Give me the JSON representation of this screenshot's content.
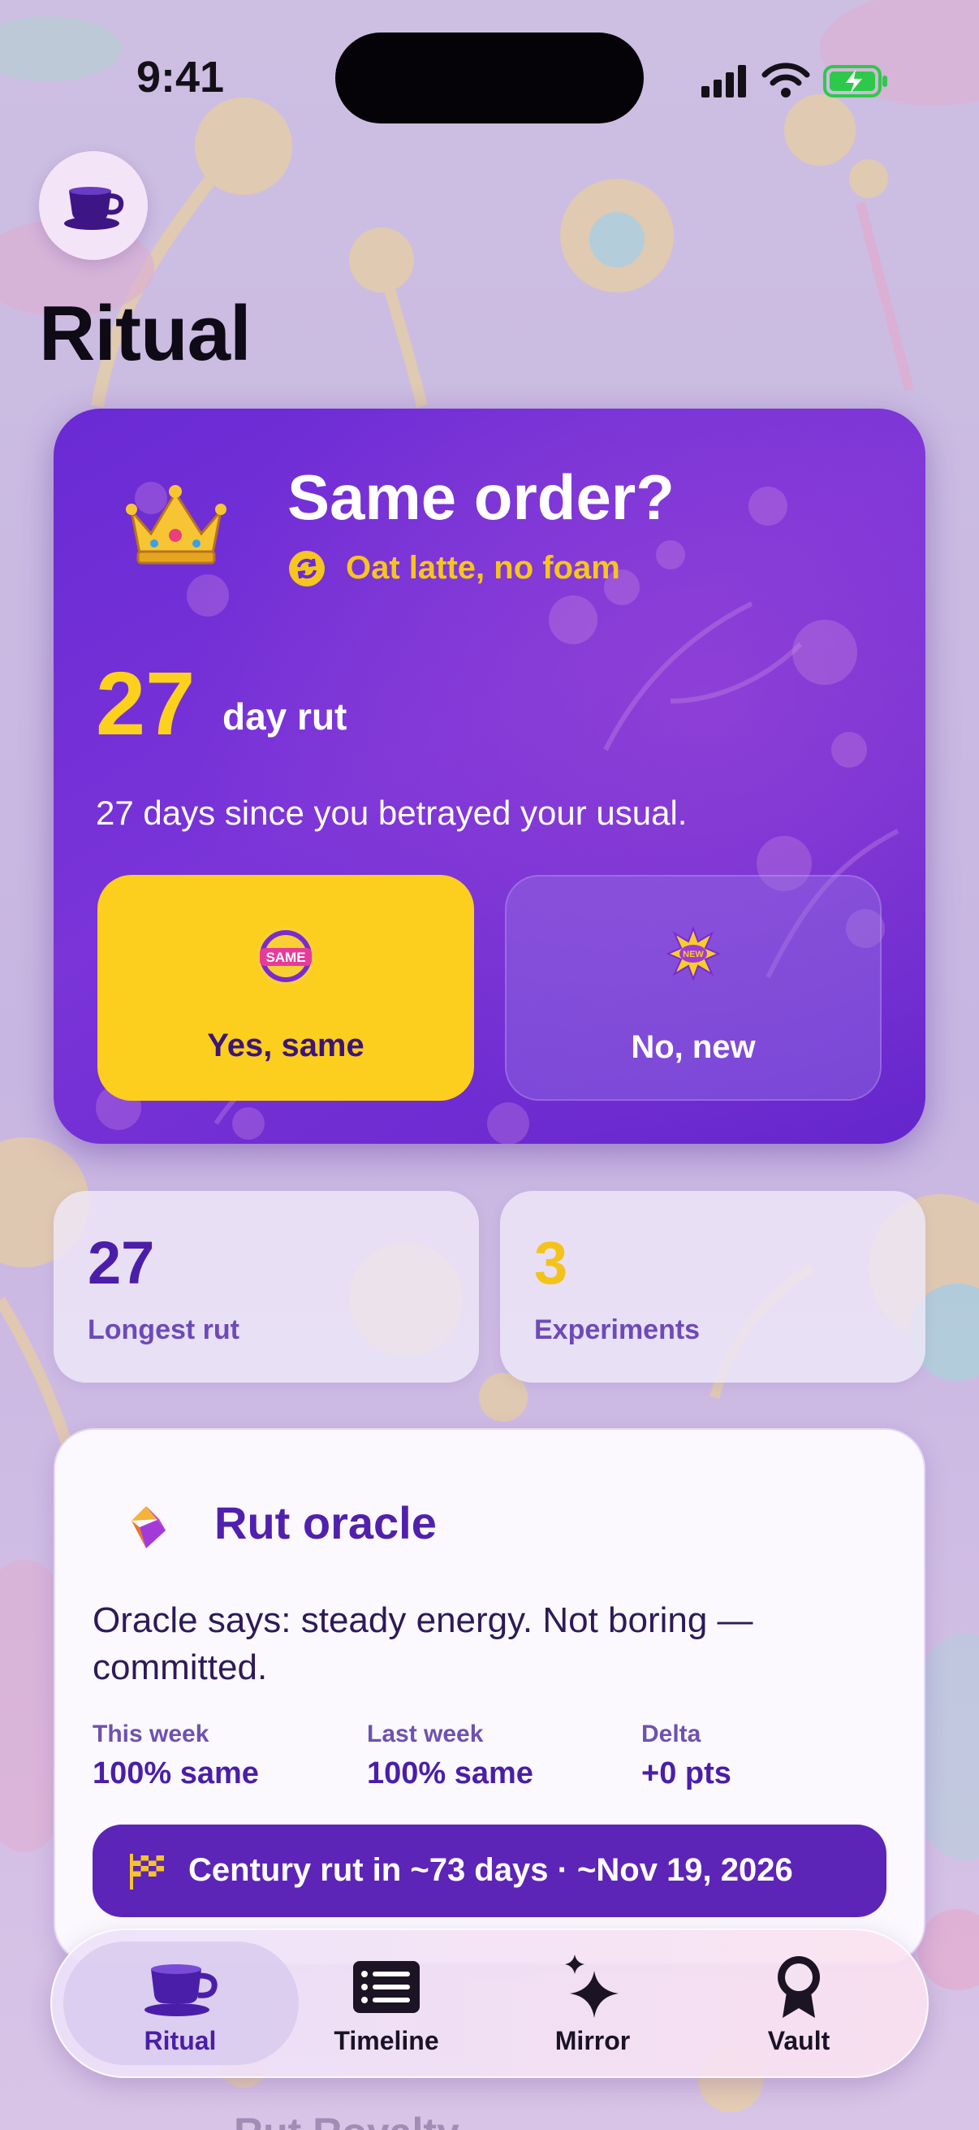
{
  "status_bar": {
    "time": "9:41"
  },
  "header": {
    "title": "Ritual",
    "avatar_icon": "coffee-cup-icon"
  },
  "hero": {
    "title": "Same order?",
    "usual_order": "Oat latte, no foam",
    "rut_days": "27",
    "rut_label": "day rut",
    "description": "27 days since you betrayed your usual.",
    "yes_label": "Yes, same",
    "no_label": "No, new",
    "yes_badge_text": "SAME",
    "no_badge_text": "NEW"
  },
  "stats": [
    {
      "value": "27",
      "label": "Longest rut"
    },
    {
      "value": "3",
      "label": "Experiments"
    }
  ],
  "oracle": {
    "title": "Rut oracle",
    "text": "Oracle says: steady energy. Not boring — committed.",
    "metrics": [
      {
        "label": "This week",
        "value": "100% same"
      },
      {
        "label": "Last week",
        "value": "100% same"
      },
      {
        "label": "Delta",
        "value": "+0 pts"
      }
    ],
    "century": "Century rut in ~73 days · ~Nov 19, 2026"
  },
  "peek": {
    "text": "Rut Royalty"
  },
  "tabs": [
    {
      "label": "Ritual",
      "icon": "coffee-cup-icon",
      "active": true
    },
    {
      "label": "Timeline",
      "icon": "list-icon",
      "active": false
    },
    {
      "label": "Mirror",
      "icon": "sparkles-icon",
      "active": false
    },
    {
      "label": "Vault",
      "icon": "award-ribbon-icon",
      "active": false
    }
  ],
  "colors": {
    "hero_purple": "#6a2ad4",
    "accent_yellow": "#fcce1e",
    "deep_purple": "#4a1ea8",
    "background_lavender": "#cbbbe0"
  }
}
